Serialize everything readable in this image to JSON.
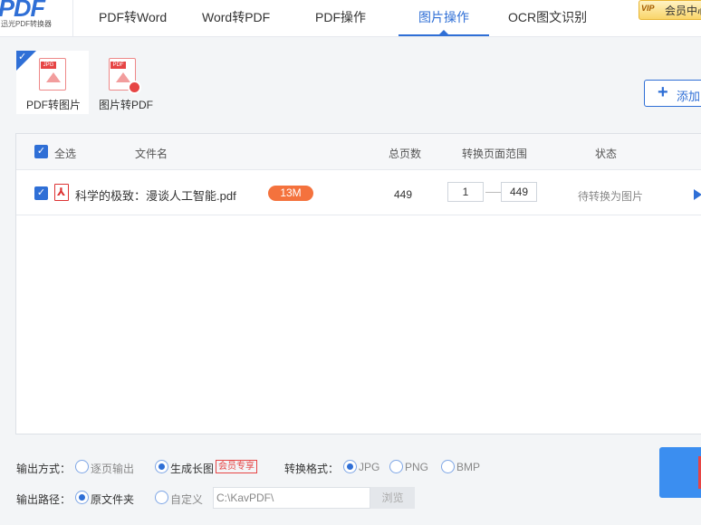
{
  "app": {
    "logo_text": "PDF",
    "logo_subtitle": "迅光PDF转换器"
  },
  "nav": {
    "items": [
      {
        "label": "PDF转Word"
      },
      {
        "label": "Word转PDF"
      },
      {
        "label": "PDF操作"
      },
      {
        "label": "图片操作",
        "active": true
      },
      {
        "label": "OCR图文识别"
      }
    ],
    "vip_badge": "VIP",
    "member_center": "会员中心"
  },
  "modes": [
    {
      "label": "PDF转图片",
      "active": true,
      "icon": "pdf-to-image-icon"
    },
    {
      "label": "图片转PDF",
      "active": false,
      "icon": "image-to-pdf-icon"
    }
  ],
  "add_button": {
    "label": "添加"
  },
  "table": {
    "headers": {
      "select_all": "全选",
      "file_name": "文件名",
      "total_pages": "总页数",
      "page_range": "转换页面范围",
      "status": "状态"
    },
    "rows": [
      {
        "checked": true,
        "file_name": "科学的极致：漫谈人工智能.pdf",
        "size": "13M",
        "pages": "449",
        "range_start": "1",
        "range_end": "449",
        "status": "待转换为图片"
      }
    ]
  },
  "options": {
    "output_mode_label": "输出方式：",
    "output_modes": [
      {
        "label": "逐页输出",
        "selected": false
      },
      {
        "label": "生成长图",
        "selected": true
      }
    ],
    "vip_only_tag": "会员专享",
    "format_label": "转换格式：",
    "formats": [
      {
        "label": "JPG",
        "selected": true
      },
      {
        "label": "PNG",
        "selected": false
      },
      {
        "label": "BMP",
        "selected": false
      }
    ],
    "path_label": "输出路径：",
    "path_modes": [
      {
        "label": "原文件夹",
        "selected": true
      },
      {
        "label": "自定义",
        "selected": false
      }
    ],
    "path_value": "C:\\KavPDF\\",
    "browse_label": "浏览"
  },
  "colors": {
    "accent": "#2f6fd6",
    "size_badge": "#f4723d",
    "danger": "#e64545"
  }
}
